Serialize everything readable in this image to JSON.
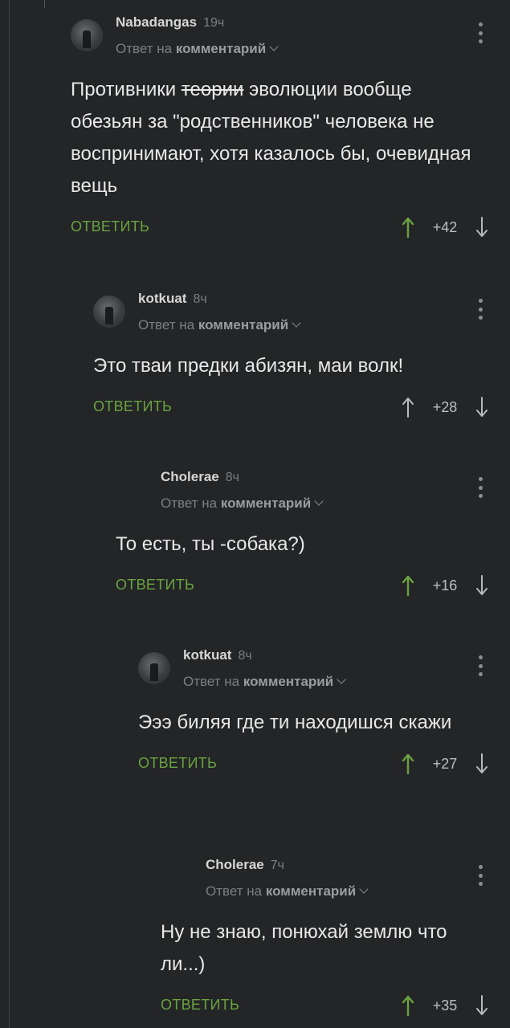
{
  "comments": [
    {
      "username": "Nabadangas",
      "time": "19ч",
      "reply_prefix": "Ответ на",
      "reply_target": "комментарий",
      "text_before": "Противники ",
      "text_strike": "теории",
      "text_after": " эволюции вообще обезьян за \"родственников\" человека не воспринимают, хотя казалось бы, очевидная вещь",
      "reply_label": "ОТВЕТИТЬ",
      "rating": "+42",
      "upvoted": true
    },
    {
      "username": "kotkuat",
      "time": "8ч",
      "reply_prefix": "Ответ на",
      "reply_target": "комментарий",
      "text": "Это тваи предки абизян, маи волк!",
      "reply_label": "ОТВЕТИТЬ",
      "rating": "+28",
      "upvoted": false
    },
    {
      "username": "Cholerae",
      "time": "8ч",
      "reply_prefix": "Ответ на",
      "reply_target": "комментарий",
      "text": "То есть, ты -собака?)",
      "reply_label": "ОТВЕТИТЬ",
      "rating": "+16",
      "upvoted": true
    },
    {
      "username": "kotkuat",
      "time": "8ч",
      "reply_prefix": "Ответ на",
      "reply_target": "комментарий",
      "text": "Эээ биляя где ти находишся скажи",
      "reply_label": "ОТВЕТИТЬ",
      "rating": "+27",
      "upvoted": true
    },
    {
      "username": "Cholerae",
      "time": "7ч",
      "reply_prefix": "Ответ на",
      "reply_target": "комментарий",
      "text": "Ну не знаю, понюхай землю что ли...)",
      "reply_label": "ОТВЕТИТЬ",
      "rating": "+35",
      "upvoted": true
    }
  ],
  "colors": {
    "background": "#242526",
    "accent_green": "#6aa341",
    "thread_line": "#3e4042",
    "arrow_neutral": "#b8bbbe"
  },
  "icons": {
    "upvote": "arrow-up-icon",
    "downvote": "arrow-down-icon",
    "menu": "kebab-menu-icon",
    "avatar": "avatar",
    "expand": "chevron-down-icon"
  }
}
